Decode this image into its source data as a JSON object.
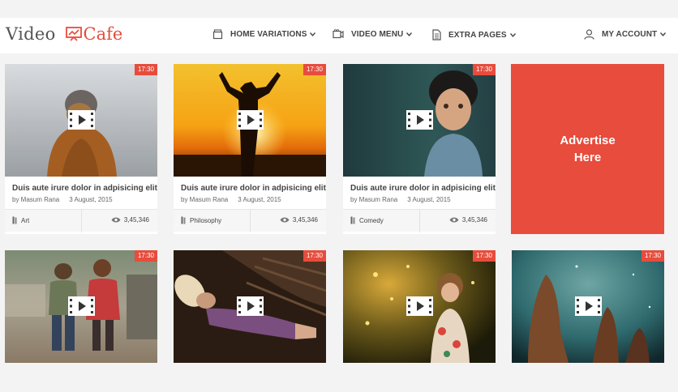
{
  "logo": {
    "part1": "Video",
    "part2": "Cafe"
  },
  "nav": [
    {
      "label": "HOME VARIATIONS",
      "icon": "box-icon"
    },
    {
      "label": "VIDEO MENU",
      "icon": "video-camera-icon"
    },
    {
      "label": "EXTRA PAGES",
      "icon": "document-icon"
    },
    {
      "label": "MY ACCOUNT",
      "icon": "user-icon"
    }
  ],
  "row1": [
    {
      "duration": "17:30",
      "title": "Duis aute irure dolor in adpisicing elit",
      "author": "by Masum Rana",
      "date": "3 August, 2015",
      "category": "Art",
      "views": "3,45,346"
    },
    {
      "duration": "17:30",
      "title": "Duis aute irure dolor in adpisicing elit",
      "author": "by Masum Rana",
      "date": "3 August, 2015",
      "category": "Philosophy",
      "views": "3,45,346"
    },
    {
      "duration": "17:30",
      "title": "Duis aute irure dolor in adpisicing elit",
      "author": "by Masum Rana",
      "date": "3 August, 2015",
      "category": "Comedy",
      "views": "3,45,346"
    }
  ],
  "ad": {
    "line1": "Advertise",
    "line2": "Here"
  },
  "row2": [
    {
      "duration": "17:30"
    },
    {
      "duration": "17:30"
    },
    {
      "duration": "17:30"
    },
    {
      "duration": "17:30"
    }
  ],
  "colors": {
    "accent": "#e74c3c",
    "text": "#444444",
    "background": "#f3f3f3"
  }
}
